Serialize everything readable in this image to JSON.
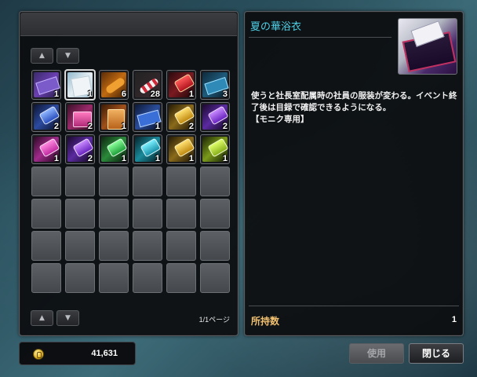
{
  "inventory": {
    "page_indicator": "1/1ページ",
    "nav_up_icon": "chevron-up-icon",
    "nav_down_icon": "chevron-down-icon",
    "slots": [
      {
        "art": "art-ticket",
        "qty": "1"
      },
      {
        "art": "art-paper",
        "qty": "1",
        "selected": true
      },
      {
        "art": "art-scroll-orange",
        "qty": "6"
      },
      {
        "art": "art-candy",
        "qty": "28"
      },
      {
        "art": "art-hammer-red",
        "qty": "1"
      },
      {
        "art": "art-ticket-blue",
        "qty": "3"
      },
      {
        "art": "art-hammer-blue",
        "qty": "2"
      },
      {
        "art": "art-box-pink",
        "qty": "2"
      },
      {
        "art": "art-board",
        "qty": "1"
      },
      {
        "art": "art-card-blue",
        "qty": "1"
      },
      {
        "art": "art-hammer-gold",
        "qty": "2"
      },
      {
        "art": "art-hammer-purple",
        "qty": "2"
      },
      {
        "art": "art-hammer-magenta",
        "qty": "1"
      },
      {
        "art": "art-hammer-purple",
        "qty": "2"
      },
      {
        "art": "art-hammer-green",
        "qty": "1"
      },
      {
        "art": "art-hammer-teal",
        "qty": "1"
      },
      {
        "art": "art-hammer-gold",
        "qty": "1"
      },
      {
        "art": "art-hammer-lime",
        "qty": "1"
      },
      {},
      {},
      {},
      {},
      {},
      {},
      {},
      {},
      {},
      {},
      {},
      {},
      {},
      {},
      {},
      {},
      {},
      {},
      {},
      {},
      {},
      {},
      {},
      {}
    ]
  },
  "detail": {
    "item_name": "夏の華浴衣",
    "description": "使うと社長室配属時の社員の服装が変わる。イベント終了後は目録で確認できるようになる。\n【モニク専用】",
    "own_label": "所持数",
    "own_count": "1"
  },
  "money": {
    "value": "41,631",
    "icon": "coin-icon"
  },
  "buttons": {
    "use_label": "使用",
    "close_label": "閉じる"
  },
  "colors": {
    "item_title": "#4ed0e6",
    "own_label": "#f0c070"
  }
}
